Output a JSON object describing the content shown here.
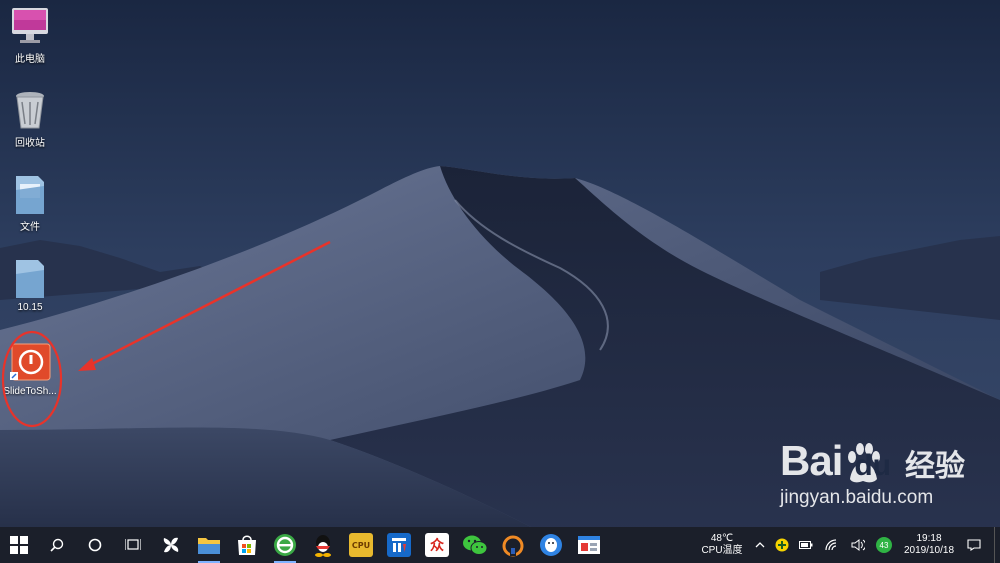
{
  "desktop": {
    "icons": [
      {
        "label": "此电脑",
        "icon": "computer-icon"
      },
      {
        "label": "回收站",
        "icon": "recycle-bin-icon"
      },
      {
        "label": "文件",
        "icon": "folder-icon"
      },
      {
        "label": "10.15",
        "icon": "folder-icon"
      },
      {
        "label": "SlideToSh...",
        "icon": "power-icon"
      }
    ],
    "annotation": {
      "color": "#e8332a"
    }
  },
  "taskbar": {
    "background": "#1b1f2a",
    "apps": [
      {
        "icon": "file-explorer-icon"
      },
      {
        "icon": "store-icon"
      },
      {
        "icon": "browser-icon"
      },
      {
        "icon": "qq-penguin-icon"
      },
      {
        "icon": "cpu-z-icon",
        "text": "CPU"
      },
      {
        "icon": "tools-icon"
      },
      {
        "icon": "app-red-icon",
        "text": "众"
      },
      {
        "icon": "wechat-icon"
      },
      {
        "icon": "vpn-icon"
      },
      {
        "icon": "tim-icon"
      },
      {
        "icon": "window-app-icon"
      }
    ],
    "tray": {
      "temp": "48℃",
      "temp_label": "CPU温度",
      "badge": "43",
      "time": "19:18",
      "date": "2019/10/18"
    }
  },
  "watermark": {
    "brand": "Bai",
    "brand2": "du",
    "suffix": "经验",
    "url": "jingyan.baidu.com"
  }
}
